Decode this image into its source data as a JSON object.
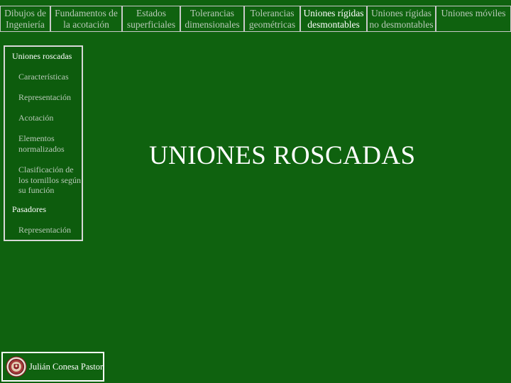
{
  "nav": {
    "tabs": [
      {
        "label": "Dibujos de Ingeniería",
        "lines": [
          "Dibujos de",
          "Ingeniería"
        ]
      },
      {
        "label": "Fundamentos de la acotación",
        "lines": [
          "Fundamentos de",
          "la acotación"
        ]
      },
      {
        "label": "Estados superficiales",
        "lines": [
          "Estados",
          "superficiales"
        ]
      },
      {
        "label": "Tolerancias dimensionales",
        "lines": [
          "Tolerancias",
          "dimensionales"
        ]
      },
      {
        "label": "Tolerancias geométricas",
        "lines": [
          "Tolerancias",
          "geométricas"
        ]
      },
      {
        "label": "Uniones rígidas desmontables",
        "lines": [
          "Uniones rígidas",
          "desmontables"
        ],
        "active": true
      },
      {
        "label": "Uniones rígidas no desmontables",
        "lines": [
          "Uniones rígidas",
          "no desmontables"
        ]
      },
      {
        "label": "Uniones móviles",
        "lines": [
          "Uniones móviles",
          ""
        ]
      }
    ]
  },
  "sidebar": {
    "items": [
      {
        "label": "Uniones roscadas",
        "level": "main"
      },
      {
        "label": "Características",
        "level": "sub"
      },
      {
        "label": "Representación",
        "level": "sub"
      },
      {
        "label": "Acotación",
        "level": "sub"
      },
      {
        "label": "Elementos normalizados",
        "level": "sub"
      },
      {
        "label": "Clasificación de los tornillos según su función",
        "level": "sub"
      },
      {
        "label": "Pasadores",
        "level": "main"
      },
      {
        "label": "Representación",
        "level": "sub"
      }
    ]
  },
  "main": {
    "title": "UNIONES ROSCADAS"
  },
  "author": {
    "name": "Julián Conesa Pastor",
    "seal_icon": "university-seal-icon"
  },
  "colors": {
    "background": "#0f620f",
    "inactive_text": "#b8c9b8",
    "active_text": "#ffffff"
  }
}
